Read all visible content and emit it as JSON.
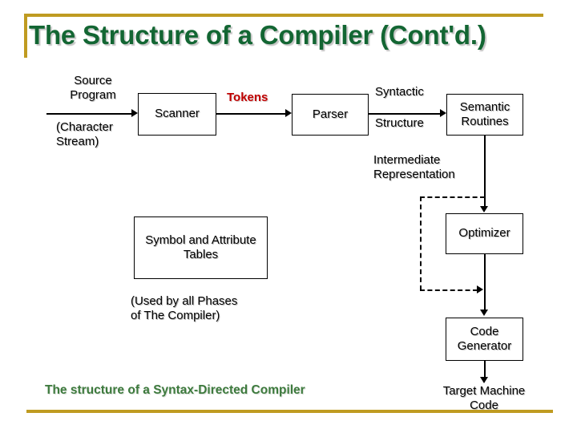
{
  "slide": {
    "title": "The Structure of a Compiler (Cont'd.)",
    "caption": "The structure of a Syntax-Directed Compiler",
    "accent_gold": "#bf9b21",
    "title_green": "#136633",
    "caption_green": "#3d7a3d",
    "tokens_red": "#c00000"
  },
  "diagram": {
    "boxes": {
      "scanner": "Scanner",
      "parser": "Parser",
      "semantic_routines": "Semantic\nRoutines",
      "symbol_tables": "Symbol and\nAttribute\nTables",
      "optimizer": "Optimizer",
      "code_generator": "Code\nGenerator"
    },
    "labels": {
      "source_program": "Source\nProgram",
      "character_stream": "(Character\nStream)",
      "tokens": "Tokens",
      "syntactic": "Syntactic",
      "structure": "Structure",
      "intermediate_representation": "Intermediate\nRepresentation",
      "used_by_all_phases": "(Used by all Phases\nof  The Compiler)",
      "target_machine_code": "Target Machine\nCode"
    }
  }
}
